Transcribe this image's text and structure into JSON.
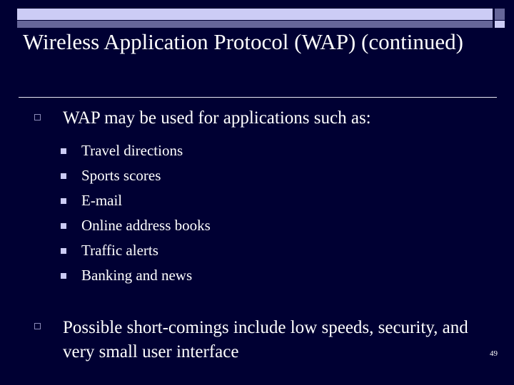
{
  "slide": {
    "background_color": "#000033",
    "title": "Wireless Application Protocol (WAP) (continued)",
    "page_number": "49",
    "decor": {
      "band_light_color": "#ccccf5",
      "band_dark_color": "#666699",
      "divider_color": "#e8e8f5"
    },
    "content": {
      "bullet_1": {
        "text": "WAP may be used for applications such as:",
        "marker": "hollow-square-bullet",
        "sub_items": [
          {
            "text": "Travel directions",
            "marker": "filled-square-bullet"
          },
          {
            "text": "Sports scores",
            "marker": "filled-square-bullet"
          },
          {
            "text": "E-mail",
            "marker": "filled-square-bullet"
          },
          {
            "text": "Online address books",
            "marker": "filled-square-bullet"
          },
          {
            "text": "Traffic alerts",
            "marker": "filled-square-bullet"
          },
          {
            "text": "Banking and news",
            "marker": "filled-square-bullet"
          }
        ]
      },
      "bullet_2": {
        "text": "Possible short-comings include low speeds, security, and very small user interface",
        "marker": "hollow-square-bullet"
      }
    }
  }
}
